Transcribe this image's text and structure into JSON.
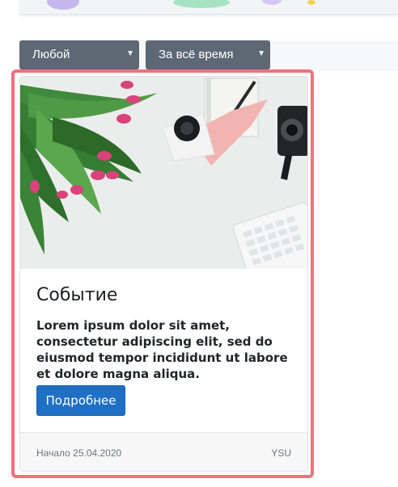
{
  "filters": {
    "type_select": {
      "value": "Любой"
    },
    "period_select": {
      "value": "За всё время"
    }
  },
  "event_card": {
    "title": "Событие",
    "description": "Lorem ipsum dolor sit amet, consectetur adipiscing elit, sed do eiusmod tempor incididunt ut labore et dolore magna aliqua.",
    "button_label": "Подробнее",
    "start_date": "Начало 25.04.2020",
    "organizer": "YSU"
  },
  "colors": {
    "select_bg": "#5d6875",
    "button_bg": "#1f6fc5",
    "highlight_border": "#f0707b"
  },
  "icons": {
    "select_arrow": "caret-down-icon"
  }
}
